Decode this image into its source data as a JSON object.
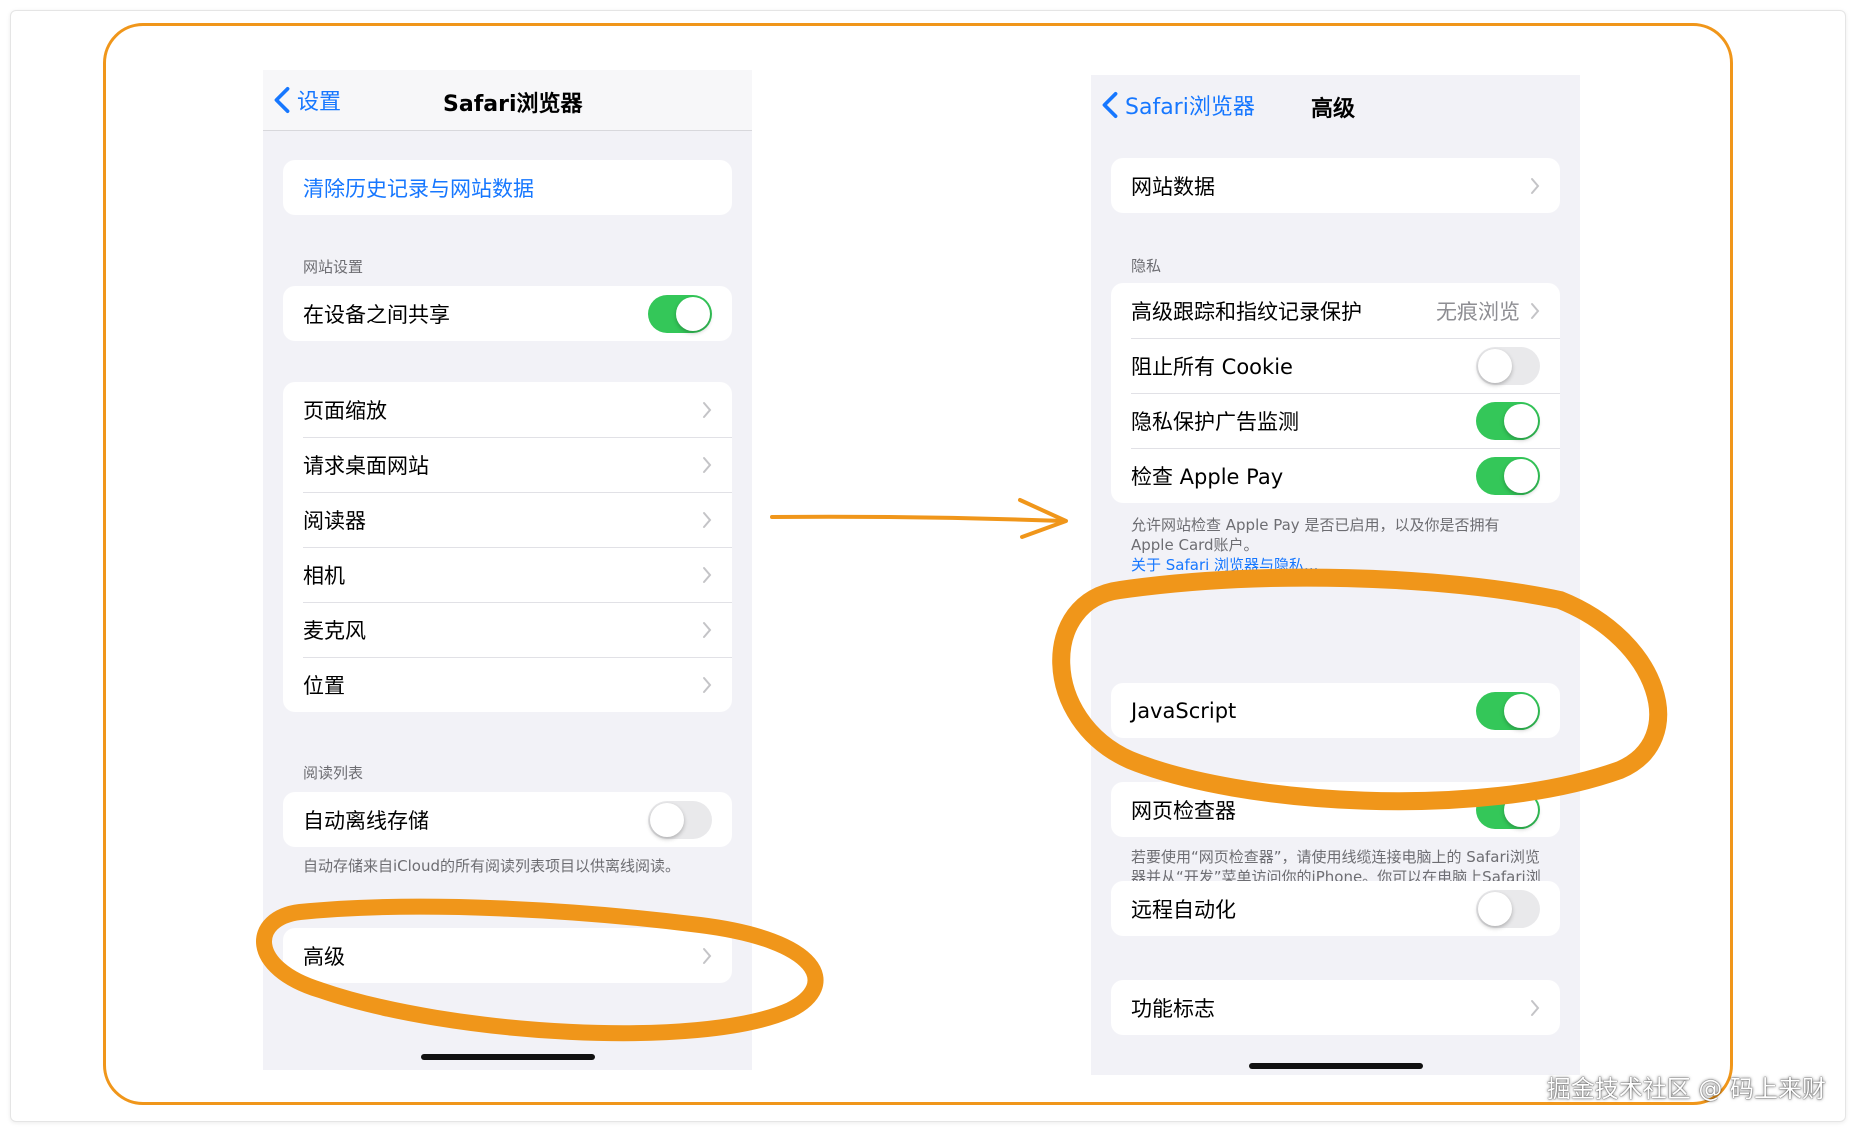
{
  "left_screen": {
    "back_label": "设置",
    "title": "Safari浏览器",
    "clear_history": "清除历史记录与网站数据",
    "website_settings_header": "网站设置",
    "share_across_devices": {
      "label": "在设备之间共享",
      "on": true
    },
    "menu_items": [
      "页面缩放",
      "请求桌面网站",
      "阅读器",
      "相机",
      "麦克风",
      "位置"
    ],
    "reading_list_header": "阅读列表",
    "auto_offline": {
      "label": "自动离线存储",
      "on": false
    },
    "reading_list_footer": "自动存储来自iCloud的所有阅读列表项目以供离线阅读。",
    "advanced": "高级"
  },
  "right_screen": {
    "back_label": "Safari浏览器",
    "title": "高级",
    "website_data": "网站数据",
    "privacy_header": "隐私",
    "tracking_protection": {
      "label": "高级跟踪和指纹记录保护",
      "value": "无痕浏览"
    },
    "block_cookies": {
      "label": "阻止所有 Cookie",
      "on": false
    },
    "privacy_ad_measurement": {
      "label": "隐私保护广告监测",
      "on": true
    },
    "check_apple_pay": {
      "label": "检查 Apple Pay",
      "on": true
    },
    "apple_pay_footer": "允许网站检查 Apple Pay 是否已启用，以及你是否拥有 Apple Card账户。",
    "privacy_link": "关于 Safari 浏览器与隐私...",
    "javascript": {
      "label": "JavaScript",
      "on": true
    },
    "web_inspector": {
      "label": "网页检查器",
      "on": true
    },
    "web_inspector_footer": "若要使用“网页检查器”，请使用线缆连接电脑上的 Safari浏览器并从“开发”菜单访问你的iPhone。你可以在电脑上Safari浏览器“设置”的“高级”部分启用“开发”菜单。",
    "remote_automation": {
      "label": "远程自动化",
      "on": false
    },
    "feature_flags": "功能标志"
  },
  "colors": {
    "accent": "#1677ff",
    "toggle_on": "#34c759",
    "annotation": "#f0961a"
  },
  "watermark": "掘金技术社区 @ 码上来财"
}
